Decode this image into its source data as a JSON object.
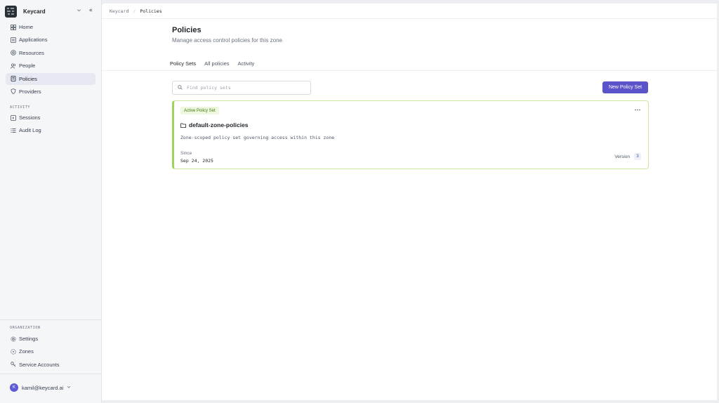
{
  "sidebar": {
    "brand": {
      "name": "Keycard",
      "chevron": "chevron-down-icon",
      "collapse": "collapse-icon"
    },
    "main_items": [
      {
        "label": "Home",
        "icon": "home-icon"
      },
      {
        "label": "Applications",
        "icon": "applications-icon"
      },
      {
        "label": "Resources",
        "icon": "resources-icon"
      },
      {
        "label": "People",
        "icon": "people-icon"
      },
      {
        "label": "Policies",
        "icon": "policies-icon",
        "active": true
      },
      {
        "label": "Providers",
        "icon": "shield-icon"
      }
    ],
    "activity_section": {
      "label": "ACTIVITY",
      "items": [
        {
          "label": "Sessions",
          "icon": "sessions-icon"
        },
        {
          "label": "Audit Log",
          "icon": "list-icon"
        }
      ]
    },
    "organization_section": {
      "label": "ORGANIZATION",
      "items": [
        {
          "label": "Settings",
          "icon": "gear-icon"
        },
        {
          "label": "Zones",
          "icon": "zones-icon"
        },
        {
          "label": "Service Accounts",
          "icon": "key-icon"
        }
      ]
    },
    "user": {
      "initial": "K",
      "email": "kamil@keycard.ai"
    }
  },
  "breadcrumb": {
    "root": "Keycard",
    "current": "Policies"
  },
  "page": {
    "title": "Policies",
    "subtitle": "Manage access control policies for this zone"
  },
  "tabs": [
    {
      "label": "Policy Sets",
      "active": true
    },
    {
      "label": "All policies"
    },
    {
      "label": "Activity"
    }
  ],
  "search": {
    "placeholder": "Find policy sets",
    "value": ""
  },
  "actions": {
    "new_policy_set": "New Policy Set"
  },
  "policy_set": {
    "badge": "Active Policy Set",
    "name": "default-zone-policies",
    "description": "Zone-scoped policy set governing access within this zone",
    "since_label": "Since",
    "since_date": "Sep 24, 2025",
    "version_label": "Version",
    "version": "3"
  },
  "colors": {
    "accent": "#5b53c9",
    "active_border": "#9ed45a",
    "badge_bg": "#eef8df",
    "badge_text": "#3f7a12"
  }
}
